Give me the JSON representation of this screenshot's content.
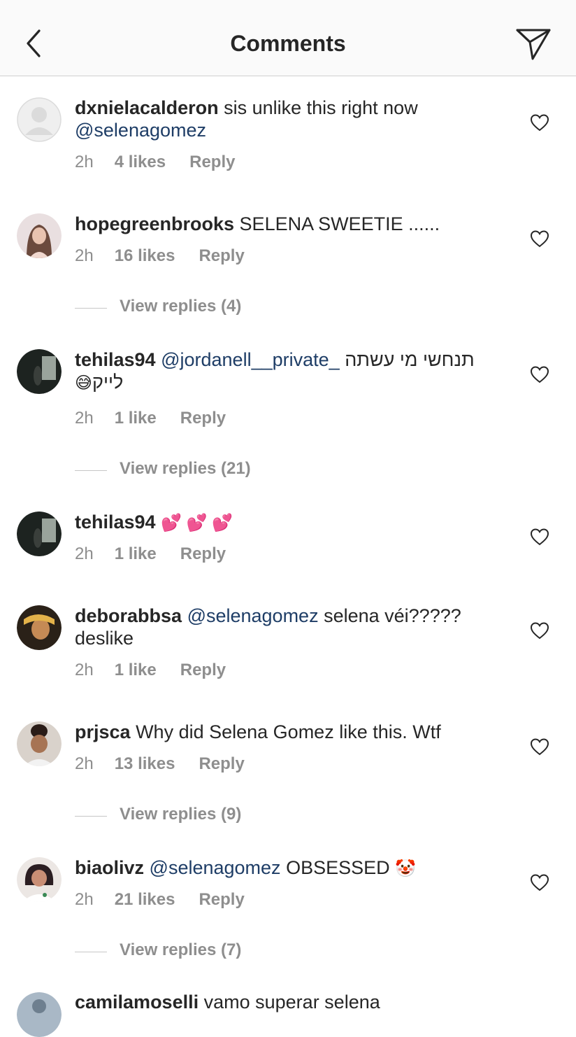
{
  "header": {
    "title": "Comments"
  },
  "comments": [
    {
      "user": "dxnielacalderon",
      "text": " sis unlike this right now ",
      "mention": "@selenagomez",
      "text2": "",
      "time": "2h",
      "likes": "4 likes",
      "reply": "Reply"
    },
    {
      "user": "hopegreenbrooks",
      "text": " SELENA SWEETIE ......",
      "time": "2h",
      "likes": "16 likes",
      "reply": "Reply",
      "view_replies": "View replies (4)"
    },
    {
      "user": "tehilas94",
      "mention": "@jordanell__private_",
      "text": " תנחשי מי עשתה",
      "text2": "לייק",
      "emoji": "😅",
      "time": "2h",
      "likes": "1 like",
      "reply": "Reply",
      "view_replies": "View replies (21)"
    },
    {
      "user": "tehilas94",
      "emoji": "💕 💕 💕",
      "time": "2h",
      "likes": "1 like",
      "reply": "Reply"
    },
    {
      "user": "deborabbsa",
      "mention": "@selenagomez",
      "text": " selena véi?????",
      "text2": "deslike",
      "time": "2h",
      "likes": "1 like",
      "reply": "Reply"
    },
    {
      "user": "prjsca",
      "text": " Why did Selena Gomez like this. Wtf",
      "time": "2h",
      "likes": "13 likes",
      "reply": "Reply",
      "view_replies": "View replies (9)"
    },
    {
      "user": "biaolivz",
      "mention": "@selenagomez",
      "text": " OBSESSED ",
      "emoji": "🤡",
      "time": "2h",
      "likes": "21 likes",
      "reply": "Reply",
      "view_replies": "View replies (7)"
    },
    {
      "user": "camilamoselli",
      "text": " vamo superar selena"
    }
  ],
  "colors": {
    "mention": "#1e3d66",
    "meta": "#8e8e8e",
    "text": "#262626"
  },
  "icons": {
    "back": "chevron-left-icon",
    "send": "paper-plane-icon",
    "like": "heart-outline-icon"
  }
}
